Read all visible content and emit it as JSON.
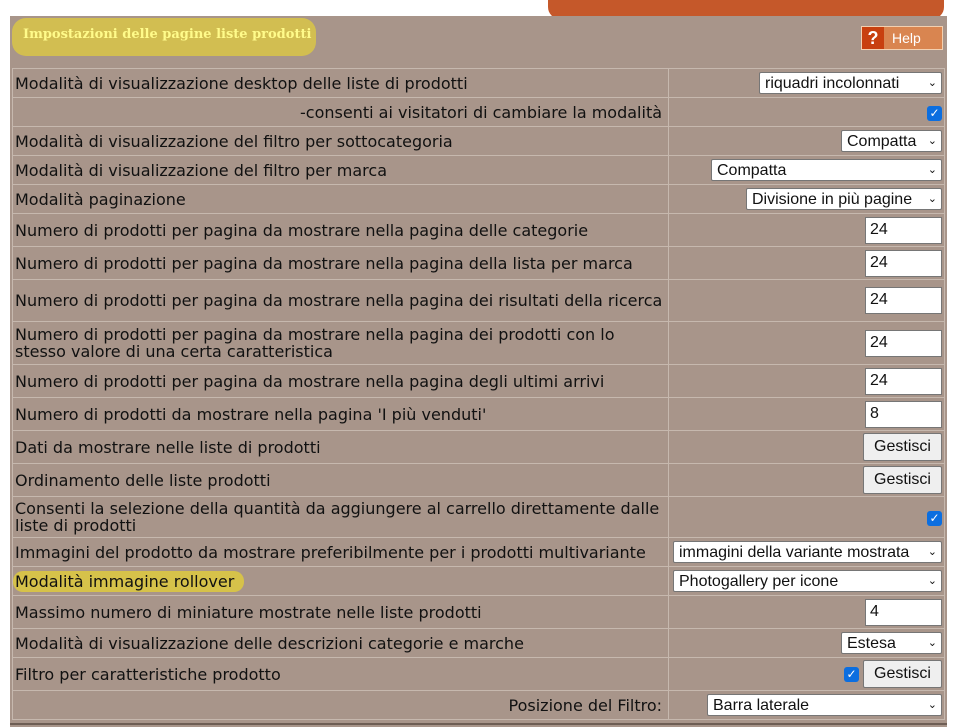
{
  "header": {
    "title": "Impostazioni delle pagine liste prodotti",
    "help_label": "Help",
    "help_glyph": "?"
  },
  "rows": [
    {
      "label": "Modalità di visualizzazione desktop delle liste di prodotti",
      "control": "select",
      "value": "riquadri incolonnati"
    },
    {
      "label": "-consenti ai visitatori di cambiare la modalità",
      "control": "checkbox",
      "checked": true
    },
    {
      "label": "Modalità di visualizzazione del filtro per sottocategoria",
      "control": "select",
      "value": "Compatta"
    },
    {
      "label": "Modalità di visualizzazione del filtro per marca",
      "control": "select",
      "value": "Compatta"
    },
    {
      "label": "Modalità paginazione",
      "control": "select",
      "value": "Divisione in più pagine"
    },
    {
      "label": "Numero di prodotti per pagina da mostrare nella pagina delle categorie",
      "control": "number",
      "value": "24"
    },
    {
      "label": "Numero di prodotti per pagina da mostrare nella pagina della lista per marca",
      "control": "number",
      "value": "24"
    },
    {
      "label": "Numero di prodotti per pagina da mostrare nella pagina dei risultati della ricerca",
      "control": "number",
      "value": "24"
    },
    {
      "label": "Numero di prodotti per pagina da mostrare nella pagina dei prodotti con lo stesso valore di una certa caratteristica",
      "control": "number",
      "value": "24"
    },
    {
      "label": "Numero di prodotti per pagina da mostrare nella pagina degli ultimi arrivi",
      "control": "number",
      "value": "24"
    },
    {
      "label": "Numero di prodotti da mostrare nella pagina 'I più venduti'",
      "control": "number",
      "value": "8"
    },
    {
      "label": "Dati da mostrare nelle liste di prodotti",
      "control": "button",
      "value": "Gestisci"
    },
    {
      "label": "Ordinamento delle liste prodotti",
      "control": "button",
      "value": "Gestisci"
    },
    {
      "label": "Consenti la selezione della quantità da aggiungere al carrello direttamente dalle liste di prodotti",
      "control": "checkbox",
      "checked": true
    },
    {
      "label": "Immagini del prodotto da mostrare preferibilmente per i prodotti multivariante",
      "control": "select",
      "value": "immagini della variante mostrata"
    },
    {
      "label": "Modalità immagine rollover",
      "control": "select",
      "value": "Photogallery per icone"
    },
    {
      "label": "Massimo numero di miniature mostrate nelle liste prodotti",
      "control": "number",
      "value": "4"
    },
    {
      "label": "Modalità di visualizzazione delle descrizioni categorie e marche",
      "control": "select",
      "value": "Estesa"
    },
    {
      "label": "Filtro per caratteristiche prodotto",
      "control": "checkbox+button",
      "checked": true,
      "value": "Gestisci"
    },
    {
      "label": "Posizione del Filtro:",
      "control": "select",
      "value": "Barra laterale"
    }
  ],
  "colors": {
    "panel_bg": "#a8958a",
    "highlight": "#d6c24a",
    "help_bg": "#d98550",
    "checkbox": "#0b6ee0"
  }
}
